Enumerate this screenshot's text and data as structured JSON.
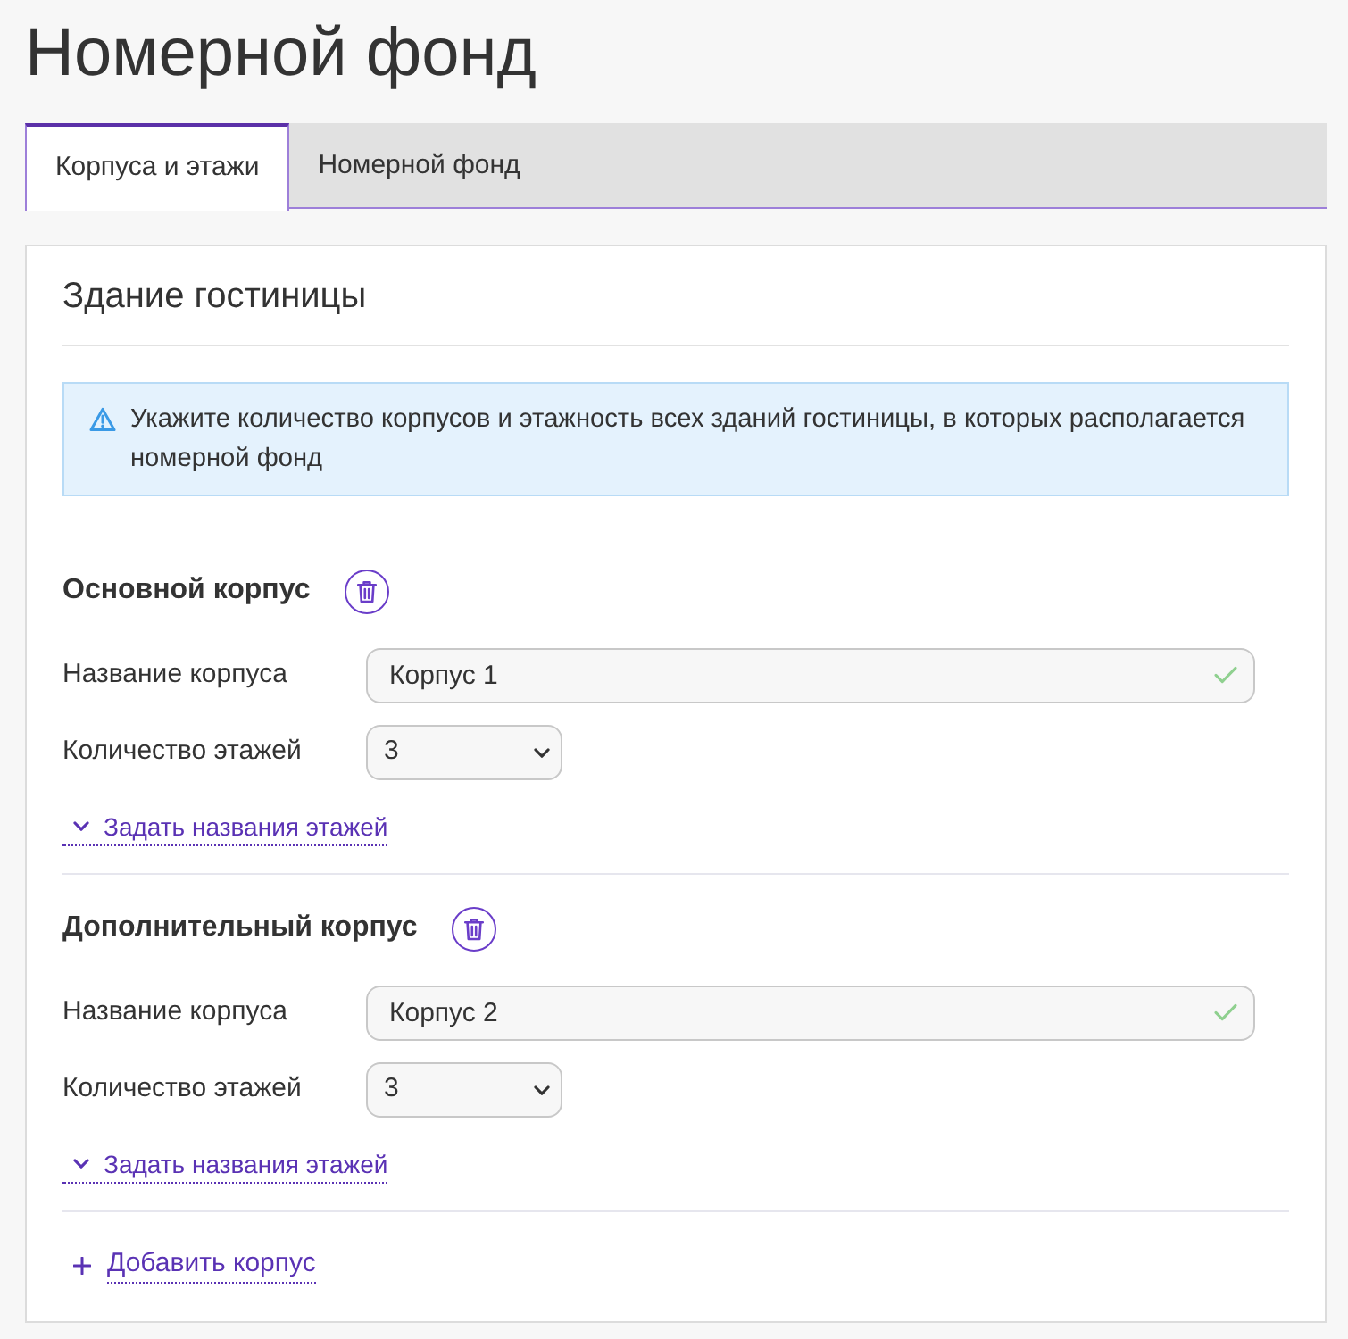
{
  "page": {
    "title": "Номерной фонд"
  },
  "tabs": [
    {
      "label": "Корпуса и этажи",
      "selected": true
    },
    {
      "label": "Номерной фонд",
      "selected": false
    }
  ],
  "card": {
    "title": "Здание гостиницы",
    "alert": {
      "kind": "warning",
      "text": "Укажите количество корпусов и этажность всех зданий гостиницы, в которых располагается номерной фонд"
    }
  },
  "buildings": [
    {
      "heading": "Основной корпус",
      "name_field": {
        "label": "Название корпуса",
        "value": "Корпус 1",
        "valid": true
      },
      "floors_field": {
        "label": "Количество этажей",
        "value": "3"
      },
      "floor_names_link": {
        "label": "Задать названия этажей",
        "expanded": false
      }
    },
    {
      "heading": "Дополнительный корпус",
      "name_field": {
        "label": "Название корпуса",
        "value": "Корпус 2",
        "valid": true
      },
      "floors_field": {
        "label": "Количество этажей",
        "value": "3"
      },
      "floor_names_link": {
        "label": "Задать названия этажей",
        "expanded": false
      }
    }
  ],
  "add_link": {
    "label": "Добавить корпус"
  }
}
